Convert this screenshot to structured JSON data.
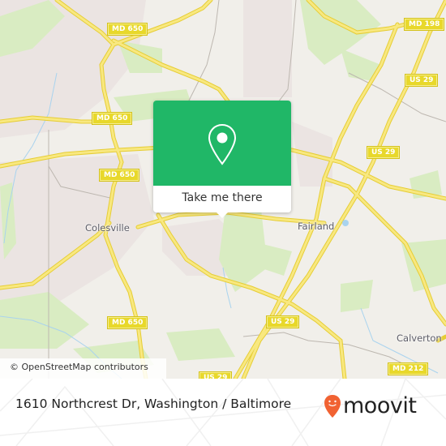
{
  "map": {
    "route_shields": [
      {
        "label": "MD 650",
        "id": "md650-north"
      },
      {
        "label": "MD 650",
        "id": "md650-mid"
      },
      {
        "label": "MD 650",
        "id": "md650-colesville"
      },
      {
        "label": "MD 650",
        "id": "md650-south"
      },
      {
        "label": "MD 198",
        "id": "md198"
      },
      {
        "label": "US 29",
        "id": "us29-north"
      },
      {
        "label": "US 29",
        "id": "us29-mid"
      },
      {
        "label": "US 29",
        "id": "us29-south"
      },
      {
        "label": "US 29",
        "id": "us29-bottom"
      },
      {
        "label": "MD 212",
        "id": "md212"
      }
    ],
    "places": [
      {
        "label": "Colesville"
      },
      {
        "label": "Fairland"
      },
      {
        "label": "Calverton"
      }
    ],
    "attribution": "© OpenStreetMap contributors",
    "colors": {
      "land": "#f1efea",
      "park": "#d9ecc2",
      "residential": "#ebe4e2",
      "road": "#f4e26a",
      "shield": "#e8d82b",
      "water": "#a9d3ee"
    }
  },
  "popup": {
    "action_label": "Take me there",
    "icon": "map-pin-icon",
    "color": "#20b767"
  },
  "footer": {
    "address": "1610 Northcrest Dr, Washington / Baltimore",
    "brand": "moovit",
    "brand_color": "#f16232"
  }
}
